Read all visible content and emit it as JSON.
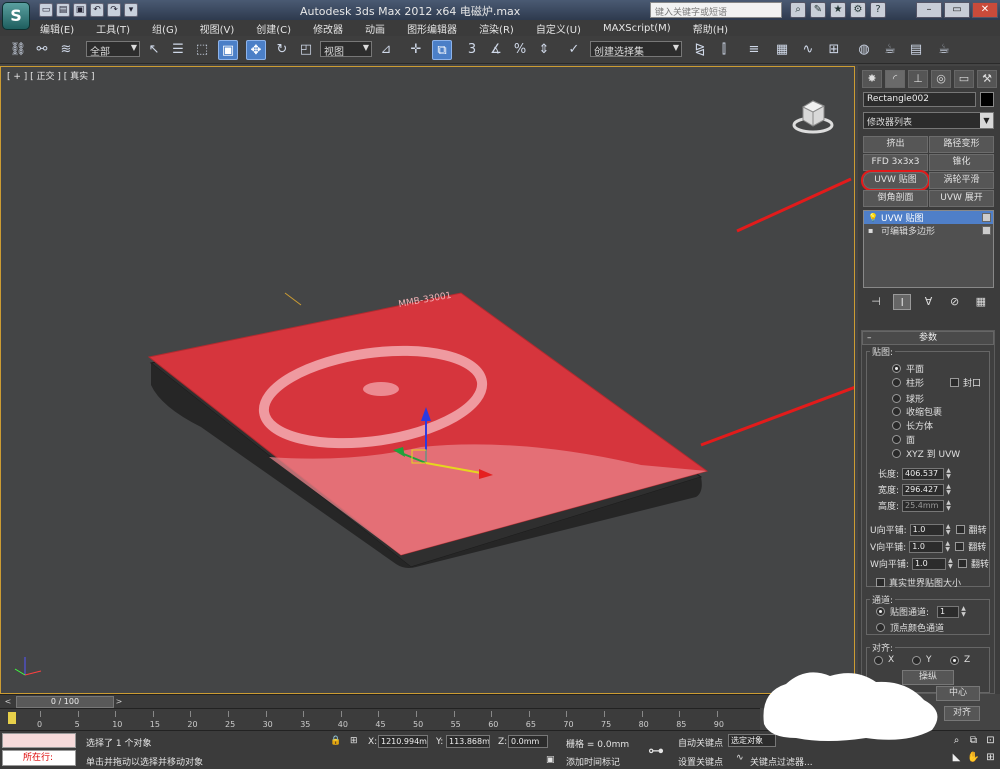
{
  "titlebar": {
    "title": "Autodesk 3ds Max  2012 x64     电磁炉.max",
    "search_placeholder": "键入关键字或短语",
    "logo": "3ds-max-logo-icon"
  },
  "menu": [
    "编辑(E)",
    "工具(T)",
    "组(G)",
    "视图(V)",
    "创建(C)",
    "修改器",
    "动画",
    "图形编辑器",
    "渲染(R)",
    "自定义(U)",
    "MAXScript(M)",
    "帮助(H)"
  ],
  "toolbar": {
    "selection_filter": "全部",
    "ref_coord": "视图",
    "named_selection": "创建选择集",
    "snap_label": "3"
  },
  "viewport": {
    "label": "[ + ] [ 正交 ] [ 真实 ]",
    "model_brand_text": "MMB-33001",
    "colors": {
      "cooktop": "#d6353d",
      "frame": "#333333",
      "background": "#444546",
      "border": "#cc9c33"
    }
  },
  "command_panel": {
    "object_name": "Rectangle002",
    "modifier_list": "修改器列表",
    "modifier_buttons": [
      "挤出",
      "路径变形",
      "FFD 3x3x3",
      "锥化",
      "UVW 贴图",
      "涡轮平滑",
      "倒角剖面",
      "UVW 展开"
    ],
    "stack": [
      "UVW 贴图",
      "可编辑多边形"
    ],
    "params": {
      "title": "参数",
      "mapping_group": "贴图:",
      "mapping_options": [
        "平面",
        "柱形",
        "球形",
        "收缩包裹",
        "长方体",
        "面",
        "XYZ 到 UVW"
      ],
      "cap_label": "封口",
      "length_label": "长度:",
      "length": "406.537",
      "width_label": "宽度:",
      "width": "296.427",
      "height_label": "高度:",
      "height": "25.4mm",
      "u_tile_label": "U向平铺:",
      "u_tile": "1.0",
      "v_tile_label": "V向平铺:",
      "v_tile": "1.0",
      "w_tile_label": "W向平铺:",
      "w_tile": "1.0",
      "flip_label": "翻转",
      "real_world": "真实世界贴图大小",
      "channel_group": "通道:",
      "map_channel_label": "贴图通道:",
      "map_channel": "1",
      "vertex_color_channel": "顶点颜色通道",
      "align_group": "对齐:",
      "align_axes": [
        "X",
        "Y",
        "Z"
      ],
      "manipulate": "操纵",
      "center": "中心",
      "fit": "对齐"
    }
  },
  "timeline": {
    "frame_display": "0 / 100",
    "ticks": [
      "0",
      "5",
      "10",
      "15",
      "20",
      "25",
      "30",
      "35",
      "40",
      "45",
      "50",
      "55",
      "60",
      "65",
      "70",
      "75",
      "80",
      "85",
      "90"
    ]
  },
  "status": {
    "maxscript_text": "所在行:",
    "selected": "选择了 1 个对象",
    "prompt": "单击并拖动以选择并移动对象",
    "x_label": "X:",
    "x": "1210.994m",
    "y_label": "Y:",
    "y": "113.868m",
    "z_label": "Z:",
    "z": "0.0mm",
    "grid": "栅格 = 0.0mm",
    "add_time_tag": "添加时间标记",
    "auto_key": "自动关键点",
    "set_key": "设置关键点",
    "selected_obj": "选定对象",
    "key_filters": "关键点过滤器..."
  }
}
